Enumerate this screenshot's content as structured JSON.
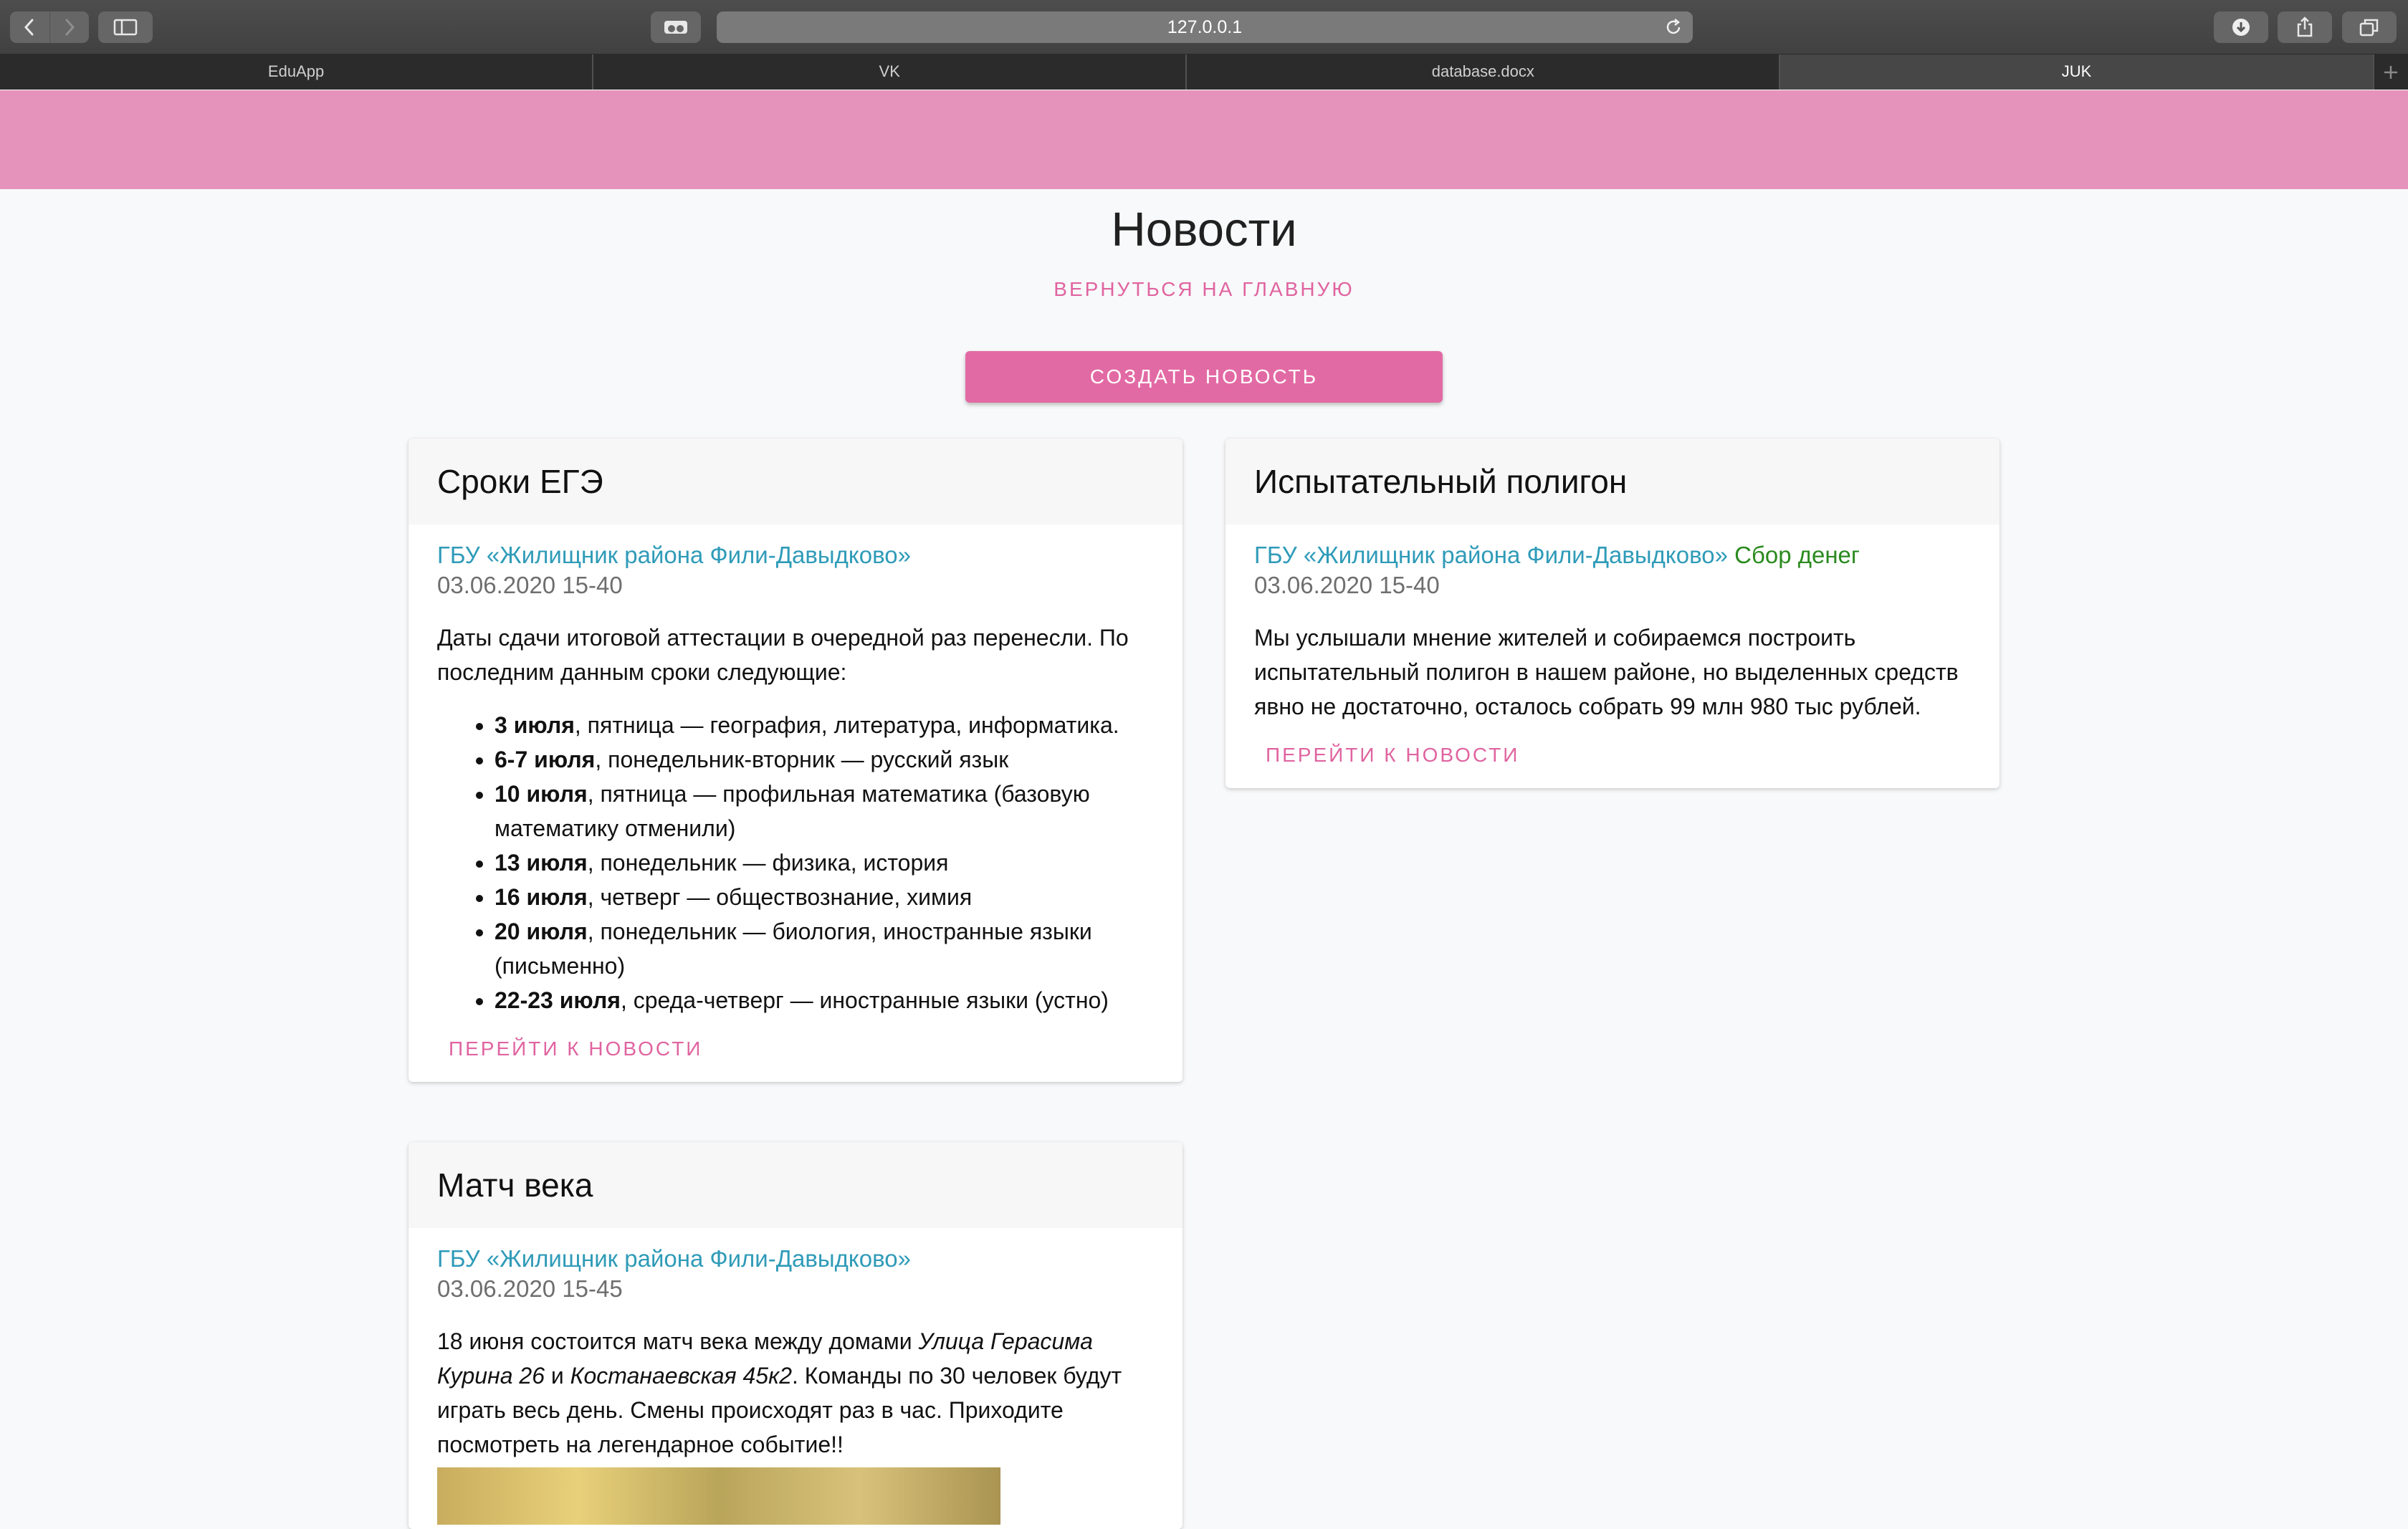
{
  "browser": {
    "url": "127.0.0.1",
    "tabs": [
      {
        "label": "EduApp"
      },
      {
        "label": "VK"
      },
      {
        "label": "database.docx"
      },
      {
        "label": "JUK"
      }
    ]
  },
  "page": {
    "title": "Новости",
    "back_link": "Вернуться на главную",
    "create_button": "Создать новость"
  },
  "news": [
    {
      "title": "Сроки ЕГЭ",
      "author": "ГБУ «Жилищник района Фили-Давыдково»",
      "tag": "",
      "date": "03.06.2020 15-40",
      "text": "Даты сдачи итоговой аттестации в очередной раз перенесли. По последним данным сроки следующие:",
      "dates": [
        {
          "date": "3 июля",
          "rest": ", пятница — география, литература, информатика."
        },
        {
          "date": "6-7 июля",
          "rest": ", понедельник-вторник — русский язык"
        },
        {
          "date": "10 июля",
          "rest": ", пятница — профильная математика (базовую математику отменили)"
        },
        {
          "date": "13 июля",
          "rest": ", понедельник — физика, история"
        },
        {
          "date": "16 июля",
          "rest": ", четверг — обществознание, химия"
        },
        {
          "date": "20 июля",
          "rest": ", понедельник — биология, иностранные языки (письменно)"
        },
        {
          "date": "22-23 июля",
          "rest": ", среда-четверг — иностранные языки (устно)"
        }
      ],
      "more": "Перейти к новости"
    },
    {
      "title": "Испытательный полигон",
      "author": "ГБУ «Жилищник района Фили-Давыдково»",
      "tag": "Сбор денег",
      "date": "03.06.2020 15-40",
      "text": "Мы услышали мнение жителей и собираемся построить испытательный полигон в нашем районе, но выделенных средств явно не достаточно, осталось собрать 99 млн 980 тыс рублей.",
      "more": "Перейти к новости"
    },
    {
      "title": "Матч века",
      "author": "ГБУ «Жилищник района Фили-Давыдково»",
      "tag": "",
      "date": "03.06.2020 15-45",
      "text_parts": {
        "p1": "18 июня состоится матч века между домами ",
        "house1": "Улица Герасима Курина 26",
        "p2": " и ",
        "house2": "Костанаевская 45к2",
        "p3": ". Команды по 30 человек будут играть весь день. Смены происходят раз в час. Приходите посмотреть на легендарное событие!!"
      }
    }
  ],
  "colors": {
    "appbar": "#e693bc",
    "accent": "#e26aa4",
    "author": "#2f9bb8",
    "tag": "#2a8a1e"
  }
}
